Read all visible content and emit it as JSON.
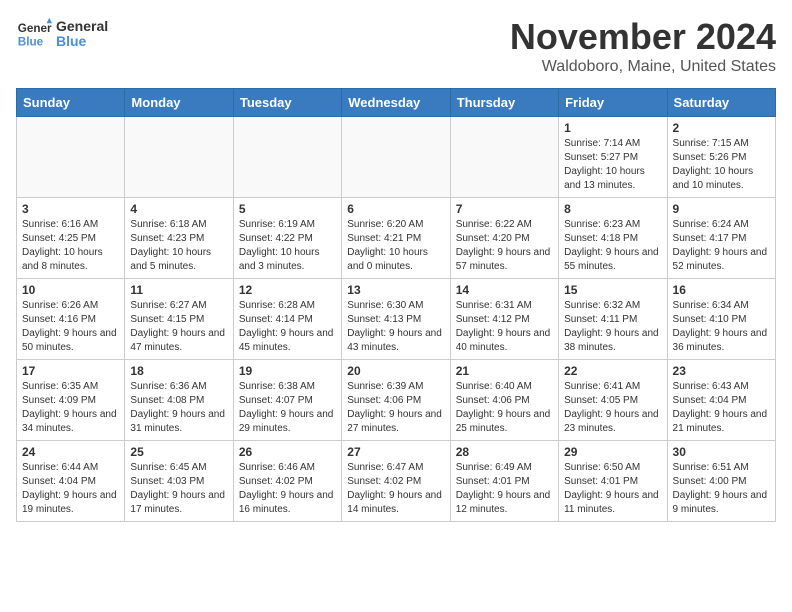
{
  "header": {
    "logo_line1": "General",
    "logo_line2": "Blue",
    "month_title": "November 2024",
    "location": "Waldoboro, Maine, United States"
  },
  "days_of_week": [
    "Sunday",
    "Monday",
    "Tuesday",
    "Wednesday",
    "Thursday",
    "Friday",
    "Saturday"
  ],
  "weeks": [
    [
      {
        "day": "",
        "info": ""
      },
      {
        "day": "",
        "info": ""
      },
      {
        "day": "",
        "info": ""
      },
      {
        "day": "",
        "info": ""
      },
      {
        "day": "",
        "info": ""
      },
      {
        "day": "1",
        "info": "Sunrise: 7:14 AM\nSunset: 5:27 PM\nDaylight: 10 hours and 13 minutes."
      },
      {
        "day": "2",
        "info": "Sunrise: 7:15 AM\nSunset: 5:26 PM\nDaylight: 10 hours and 10 minutes."
      }
    ],
    [
      {
        "day": "3",
        "info": "Sunrise: 6:16 AM\nSunset: 4:25 PM\nDaylight: 10 hours and 8 minutes."
      },
      {
        "day": "4",
        "info": "Sunrise: 6:18 AM\nSunset: 4:23 PM\nDaylight: 10 hours and 5 minutes."
      },
      {
        "day": "5",
        "info": "Sunrise: 6:19 AM\nSunset: 4:22 PM\nDaylight: 10 hours and 3 minutes."
      },
      {
        "day": "6",
        "info": "Sunrise: 6:20 AM\nSunset: 4:21 PM\nDaylight: 10 hours and 0 minutes."
      },
      {
        "day": "7",
        "info": "Sunrise: 6:22 AM\nSunset: 4:20 PM\nDaylight: 9 hours and 57 minutes."
      },
      {
        "day": "8",
        "info": "Sunrise: 6:23 AM\nSunset: 4:18 PM\nDaylight: 9 hours and 55 minutes."
      },
      {
        "day": "9",
        "info": "Sunrise: 6:24 AM\nSunset: 4:17 PM\nDaylight: 9 hours and 52 minutes."
      }
    ],
    [
      {
        "day": "10",
        "info": "Sunrise: 6:26 AM\nSunset: 4:16 PM\nDaylight: 9 hours and 50 minutes."
      },
      {
        "day": "11",
        "info": "Sunrise: 6:27 AM\nSunset: 4:15 PM\nDaylight: 9 hours and 47 minutes."
      },
      {
        "day": "12",
        "info": "Sunrise: 6:28 AM\nSunset: 4:14 PM\nDaylight: 9 hours and 45 minutes."
      },
      {
        "day": "13",
        "info": "Sunrise: 6:30 AM\nSunset: 4:13 PM\nDaylight: 9 hours and 43 minutes."
      },
      {
        "day": "14",
        "info": "Sunrise: 6:31 AM\nSunset: 4:12 PM\nDaylight: 9 hours and 40 minutes."
      },
      {
        "day": "15",
        "info": "Sunrise: 6:32 AM\nSunset: 4:11 PM\nDaylight: 9 hours and 38 minutes."
      },
      {
        "day": "16",
        "info": "Sunrise: 6:34 AM\nSunset: 4:10 PM\nDaylight: 9 hours and 36 minutes."
      }
    ],
    [
      {
        "day": "17",
        "info": "Sunrise: 6:35 AM\nSunset: 4:09 PM\nDaylight: 9 hours and 34 minutes."
      },
      {
        "day": "18",
        "info": "Sunrise: 6:36 AM\nSunset: 4:08 PM\nDaylight: 9 hours and 31 minutes."
      },
      {
        "day": "19",
        "info": "Sunrise: 6:38 AM\nSunset: 4:07 PM\nDaylight: 9 hours and 29 minutes."
      },
      {
        "day": "20",
        "info": "Sunrise: 6:39 AM\nSunset: 4:06 PM\nDaylight: 9 hours and 27 minutes."
      },
      {
        "day": "21",
        "info": "Sunrise: 6:40 AM\nSunset: 4:06 PM\nDaylight: 9 hours and 25 minutes."
      },
      {
        "day": "22",
        "info": "Sunrise: 6:41 AM\nSunset: 4:05 PM\nDaylight: 9 hours and 23 minutes."
      },
      {
        "day": "23",
        "info": "Sunrise: 6:43 AM\nSunset: 4:04 PM\nDaylight: 9 hours and 21 minutes."
      }
    ],
    [
      {
        "day": "24",
        "info": "Sunrise: 6:44 AM\nSunset: 4:04 PM\nDaylight: 9 hours and 19 minutes."
      },
      {
        "day": "25",
        "info": "Sunrise: 6:45 AM\nSunset: 4:03 PM\nDaylight: 9 hours and 17 minutes."
      },
      {
        "day": "26",
        "info": "Sunrise: 6:46 AM\nSunset: 4:02 PM\nDaylight: 9 hours and 16 minutes."
      },
      {
        "day": "27",
        "info": "Sunrise: 6:47 AM\nSunset: 4:02 PM\nDaylight: 9 hours and 14 minutes."
      },
      {
        "day": "28",
        "info": "Sunrise: 6:49 AM\nSunset: 4:01 PM\nDaylight: 9 hours and 12 minutes."
      },
      {
        "day": "29",
        "info": "Sunrise: 6:50 AM\nSunset: 4:01 PM\nDaylight: 9 hours and 11 minutes."
      },
      {
        "day": "30",
        "info": "Sunrise: 6:51 AM\nSunset: 4:00 PM\nDaylight: 9 hours and 9 minutes."
      }
    ]
  ]
}
